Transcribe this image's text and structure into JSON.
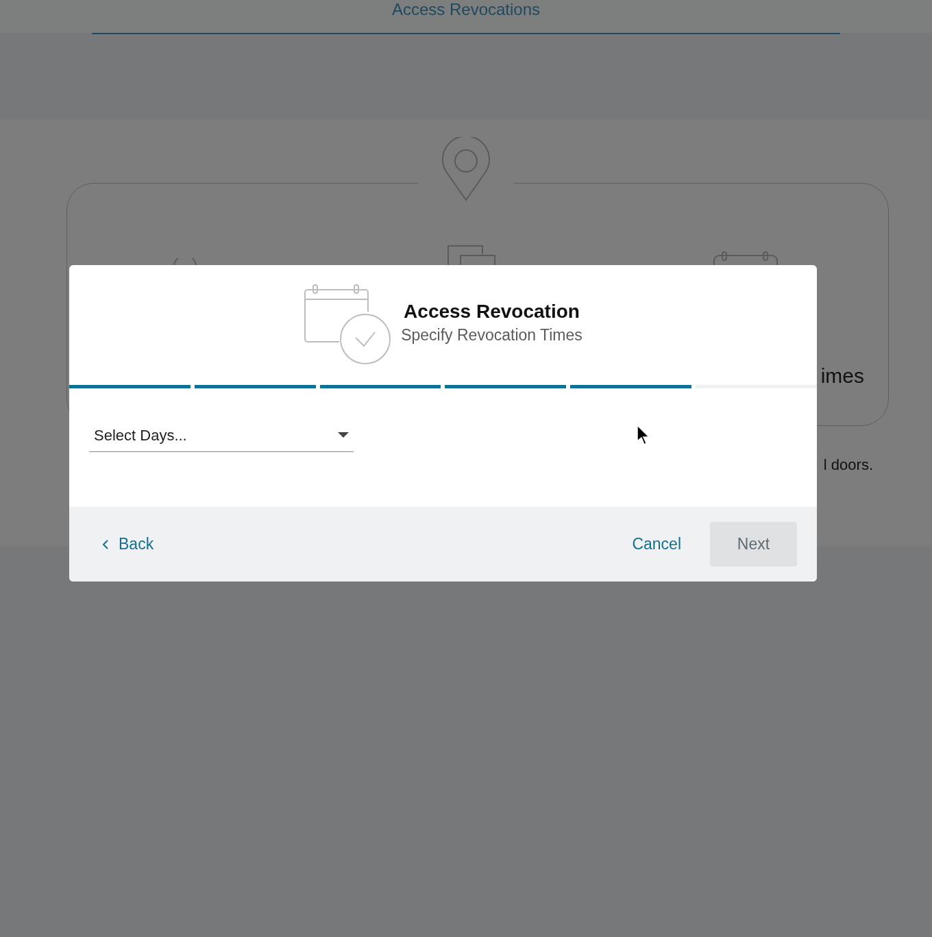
{
  "page": {
    "tab": {
      "label": "Access Revocations",
      "selected": true
    }
  },
  "background_card": {
    "partial_label": "imes",
    "partial_text": "l doors."
  },
  "modal": {
    "title": "Access Revocation",
    "subtitle": "Specify Revocation Times",
    "steps": [
      {
        "complete": true
      },
      {
        "complete": true
      },
      {
        "complete": true
      },
      {
        "complete": true
      },
      {
        "complete": true
      },
      {
        "complete": false
      }
    ],
    "days_select": {
      "placeholder": "Select Days..."
    },
    "footer": {
      "back": "Back",
      "cancel": "Cancel",
      "next": {
        "label": "Next",
        "disabled": true
      }
    }
  }
}
